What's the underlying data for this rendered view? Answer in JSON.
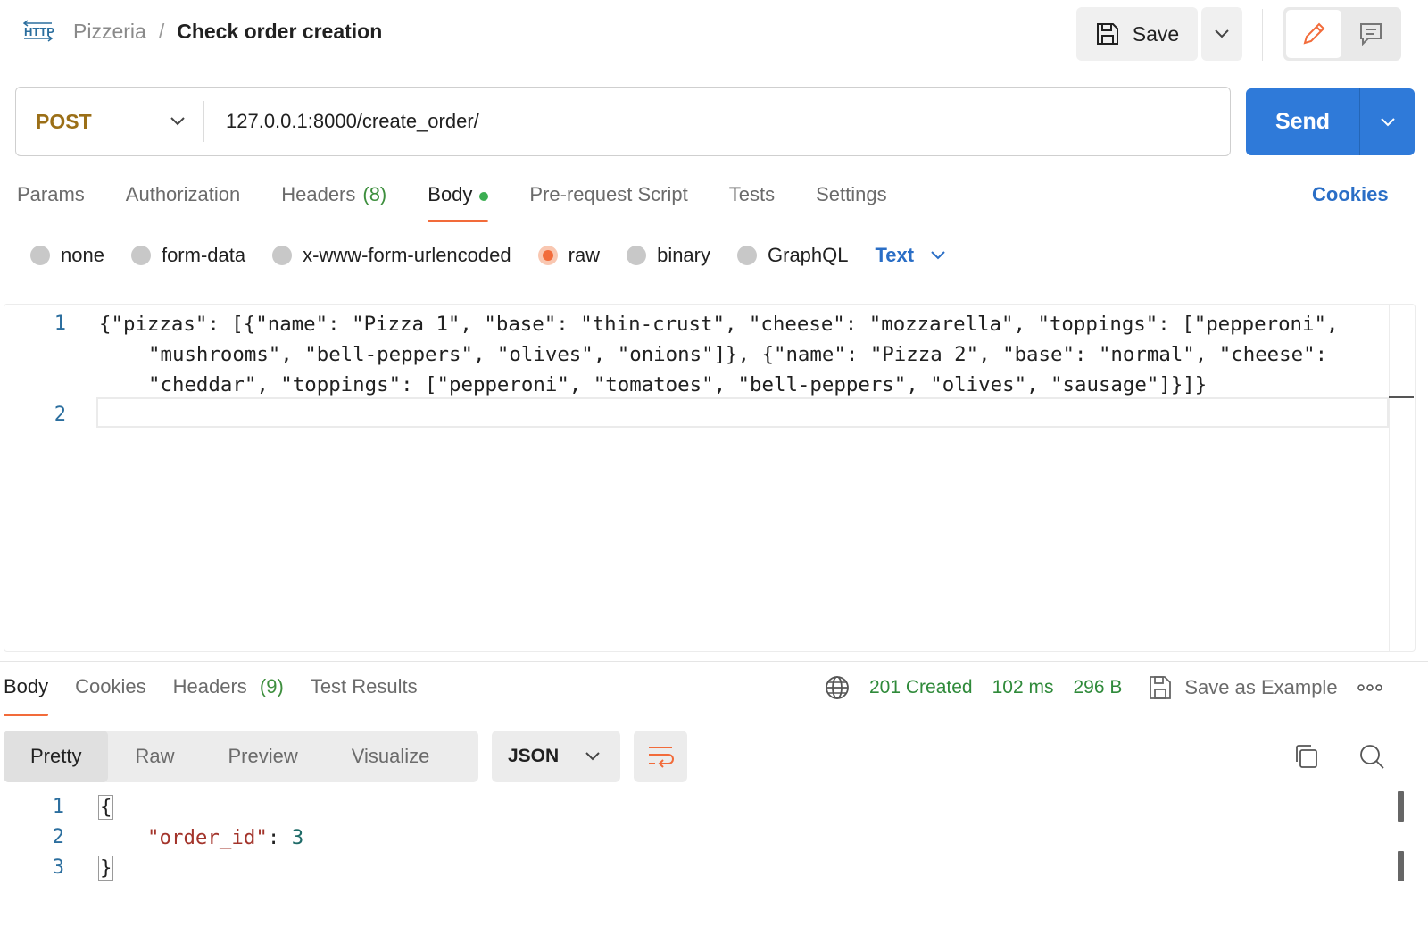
{
  "header": {
    "protocol_icon": "HTTP",
    "collection": "Pizzeria",
    "separator": "/",
    "request_name": "Check order creation",
    "save_label": "Save",
    "mode_icons": [
      "pencil-icon",
      "comment-icon"
    ]
  },
  "request": {
    "method": "POST",
    "url": "127.0.0.1:8000/create_order/",
    "send_label": "Send"
  },
  "request_tabs": {
    "params": "Params",
    "authorization": "Authorization",
    "headers": "Headers",
    "headers_count": "(8)",
    "body": "Body",
    "pre_request": "Pre-request Script",
    "tests": "Tests",
    "settings": "Settings",
    "cookies": "Cookies"
  },
  "body_types": {
    "none": "none",
    "form_data": "form-data",
    "urlencoded": "x-www-form-urlencoded",
    "raw": "raw",
    "binary": "binary",
    "graphql": "GraphQL",
    "selected": "raw",
    "text_type": "Text"
  },
  "request_editor": {
    "line_numbers": [
      "1",
      "2"
    ],
    "lines": [
      "{\"pizzas\": [{\"name\": \"Pizza 1\", \"base\": \"thin-crust\", \"cheese\": \"mozzarella\", \"toppings\": [\"pepperoni\",",
      "\"mushrooms\", \"bell-peppers\", \"olives\", \"onions\"]}, {\"name\": \"Pizza 2\", \"base\": \"normal\", \"cheese\":",
      "\"cheddar\", \"toppings\": [\"pepperoni\", \"tomatoes\", \"bell-peppers\", \"olives\", \"sausage\"]}]}"
    ]
  },
  "response_tabs": {
    "body": "Body",
    "cookies": "Cookies",
    "headers": "Headers",
    "headers_count": "(9)",
    "test_results": "Test Results"
  },
  "response_meta": {
    "status": "201 Created",
    "time": "102 ms",
    "size": "296 B",
    "save_example": "Save as Example",
    "status_color": "#2f8a3a"
  },
  "response_view": {
    "pretty": "Pretty",
    "raw": "Raw",
    "preview": "Preview",
    "visualize": "Visualize",
    "format": "JSON"
  },
  "response_body": {
    "line_numbers": [
      "1",
      "2",
      "3"
    ],
    "open_brace": "{",
    "key": "\"order_id\"",
    "colon": ": ",
    "value": "3",
    "close_brace": "}"
  },
  "colors": {
    "accent": "#f26b3a",
    "send_button": "#2f7ad9",
    "method": "#9b6f17",
    "link": "#2a6ec6"
  }
}
